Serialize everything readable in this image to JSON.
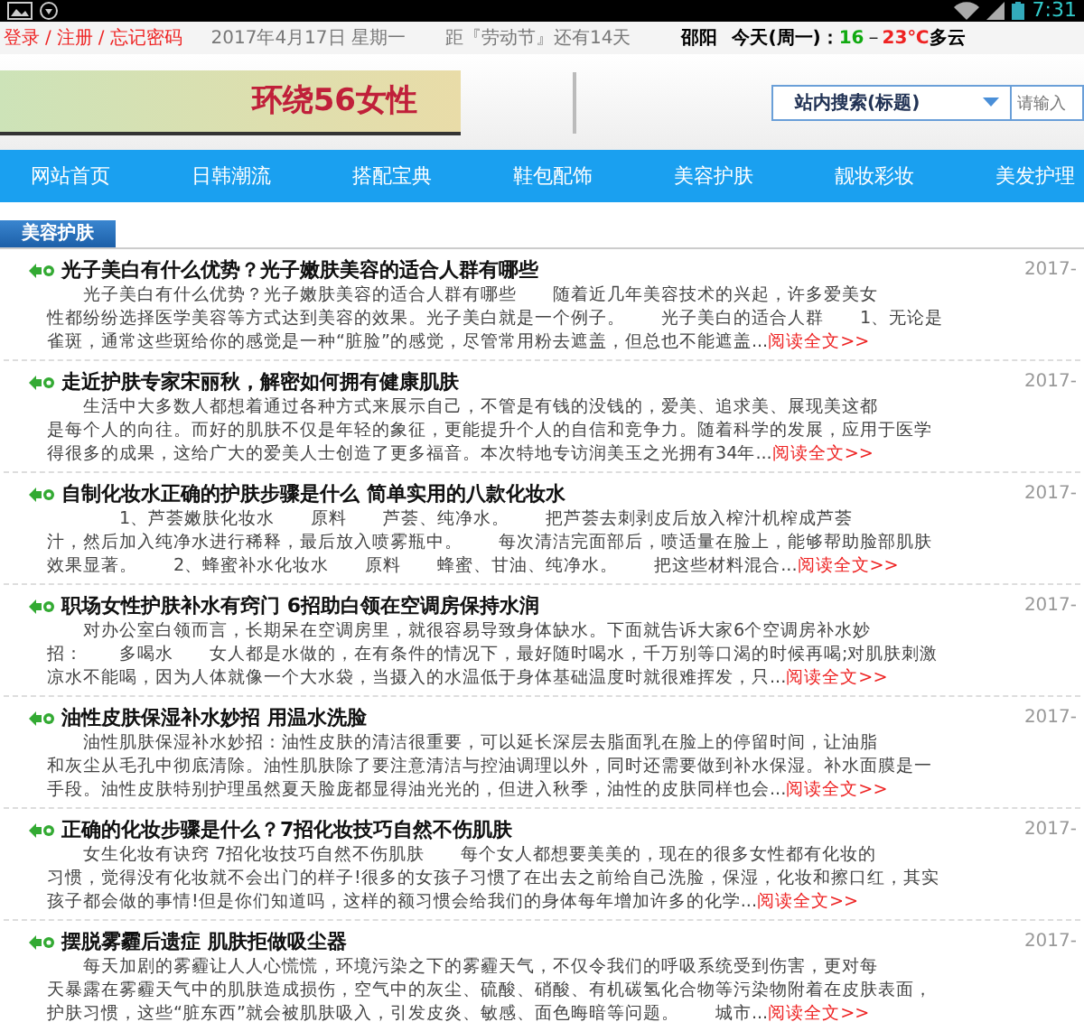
{
  "status_bar": {
    "time": "7:31"
  },
  "top_bar": {
    "links": [
      "登录",
      "注册",
      "忘记密码"
    ],
    "separator": "/",
    "date": "2017年4月17日 星期一",
    "countdown": "距『劳动节』还有14天",
    "city": "邵阳",
    "day": "今天(周一)：",
    "low": "16",
    "dash": "－",
    "high": "23℃",
    "weather": "多云"
  },
  "header": {
    "logo": "环绕56女性",
    "search_select": "站内搜索(标题)",
    "search": {
      "placeholder": "请输入"
    }
  },
  "nav": [
    "网站首页",
    "日韩潮流",
    "搭配宝典",
    "鞋包配饰",
    "美容护肤",
    "靓妆彩妆",
    "美发护理"
  ],
  "section": {
    "title": "美容护肤"
  },
  "articles": [
    {
      "title": "光子美白有什么优势？光子嫩肤美容的适合人群有哪些",
      "date": "2017-",
      "lines": [
        "光子美白有什么优势？光子嫩肤美容的适合人群有哪些　　随着近几年美容技术的兴起，许多爱美女",
        "性都纷纷选择医学美容等方式达到美容的效果。光子美白就是一个例子。　　光子美白的适合人群　　1、无论是",
        "雀斑，通常这些斑给你的感觉是一种“脏脸”的感觉，尽管常用粉去遮盖，但总也不能遮盖..."
      ],
      "more": "阅读全文>>"
    },
    {
      "title": "走近护肤专家宋丽秋，解密如何拥有健康肌肤",
      "date": "2017-",
      "lines": [
        "生活中大多数人都想着通过各种方式来展示自己，不管是有钱的没钱的，爱美、追求美、展现美这都",
        "是每个人的向往。而好的肌肤不仅是年轻的象征，更能提升个人的自信和竞争力。随着科学的发展，应用于医学",
        "得很多的成果，这给广大的爱美人士创造了更多福音。本次特地专访润美玉之光拥有34年..."
      ],
      "more": "阅读全文>>"
    },
    {
      "title": "自制化妆水正确的护肤步骤是什么 简单实用的八款化妆水",
      "date": "2017-",
      "lines": [
        "　　1、芦荟嫩肤化妆水　　原料　　芦荟、纯净水。　　把芦荟去刺剥皮后放入榨汁机榨成芦荟",
        "汁，然后加入纯净水进行稀释，最后放入喷雾瓶中。　　每次清洁完面部后，喷适量在脸上，能够帮助脸部肌肤",
        "效果显著。　　2、蜂蜜补水化妆水　　原料　　蜂蜜、甘油、纯净水。　　把这些材料混合..."
      ],
      "more": "阅读全文>>"
    },
    {
      "title": "职场女性护肤补水有窍门 6招助白领在空调房保持水润",
      "date": "2017-",
      "lines": [
        "对办公室白领而言，长期呆在空调房里，就很容易导致身体缺水。下面就告诉大家6个空调房补水妙",
        "招：　　多喝水　　女人都是水做的，在有条件的情况下，最好随时喝水，千万别等口渴的时候再喝;对肌肤刺激",
        "凉水不能喝，因为人体就像一个大水袋，当摄入的水温低于身体基础温度时就很难挥发，只..."
      ],
      "more": "阅读全文>>"
    },
    {
      "title": "油性皮肤保湿补水妙招 用温水洗脸",
      "date": "2017-",
      "lines": [
        "油性肌肤保湿补水妙招：油性皮肤的清洁很重要，可以延长深层去脂面乳在脸上的停留时间，让油脂",
        "和灰尘从毛孔中彻底清除。油性肌肤除了要注意清洁与控油调理以外，同时还需要做到补水保湿。补水面膜是一",
        "手段。油性皮肤特别护理虽然夏天脸庞都显得油光光的，但进入秋季，油性的皮肤同样也会..."
      ],
      "more": "阅读全文>>"
    },
    {
      "title": "正确的化妆步骤是什么？7招化妆技巧自然不伤肌肤",
      "date": "2017-",
      "lines": [
        "女生化妆有诀窍 7招化妆技巧自然不伤肌肤　　每个女人都想要美美的，现在的很多女性都有化妆的",
        "习惯，觉得没有化妆就不会出门的样子!很多的女孩子习惯了在出去之前给自己洗脸，保湿，化妆和擦口红，其实",
        "孩子都会做的事情!但是你们知道吗，这样的额习惯会给我们的身体每年增加许多的化学..."
      ],
      "more": "阅读全文>>"
    },
    {
      "title": "摆脱雾霾后遗症 肌肤拒做吸尘器",
      "date": "2017-",
      "lines": [
        "每天加剧的雾霾让人人心慌慌，环境污染之下的雾霾天气，不仅令我们的呼吸系统受到伤害，更对每",
        "天暴露在雾霾天气中的肌肤造成损伤，空气中的灰尘、硫酸、硝酸、有机碳氢化合物等污染物附着在皮肤表面，",
        "护肤习惯，这些“脏东西”就会被肌肤吸入，引发皮炎、敏感、面色晦暗等问题。　　城市..."
      ],
      "more": "阅读全文>>"
    }
  ]
}
